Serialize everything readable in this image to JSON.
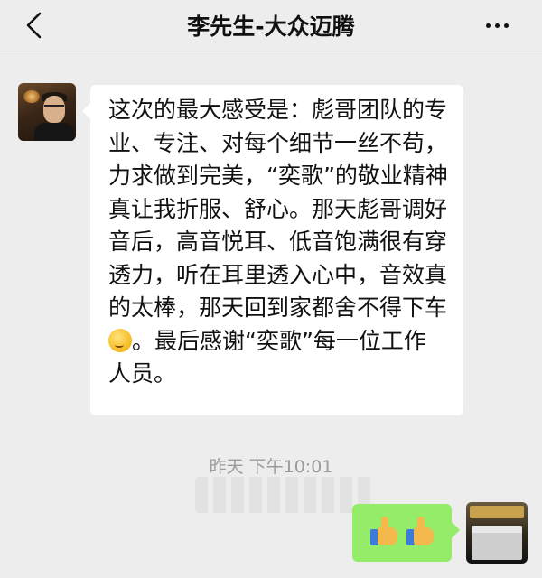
{
  "header": {
    "title": "李先生-大众迈腾",
    "back_icon": "chevron-left-icon",
    "more_icon": "more-dots-icon"
  },
  "messages": [
    {
      "side": "left",
      "text_before_emoji": "这次的最大感受是：彪哥团队的专业、专注、对每个细节一丝不苟，力求做到完美，“奕歌”的敬业精神真让我折服、舒心。那天彪哥调好音后，高音悦耳、低音饱满很有穿透力，听在耳里透入心中，音效真的太棒，那天回到家都舍不得下车",
      "emoji": "thinking-face-emoji",
      "text_after_emoji": "。最后感谢“奕歌”每一位工作人员。"
    },
    {
      "side": "right",
      "content": "thumbs-up-emoji x2"
    }
  ],
  "timestamp": "昨天 下午10:01",
  "colors": {
    "background": "#ededed",
    "incoming_bubble": "#ffffff",
    "outgoing_bubble": "#95ec69",
    "timestamp_text": "#9a9a9a"
  }
}
